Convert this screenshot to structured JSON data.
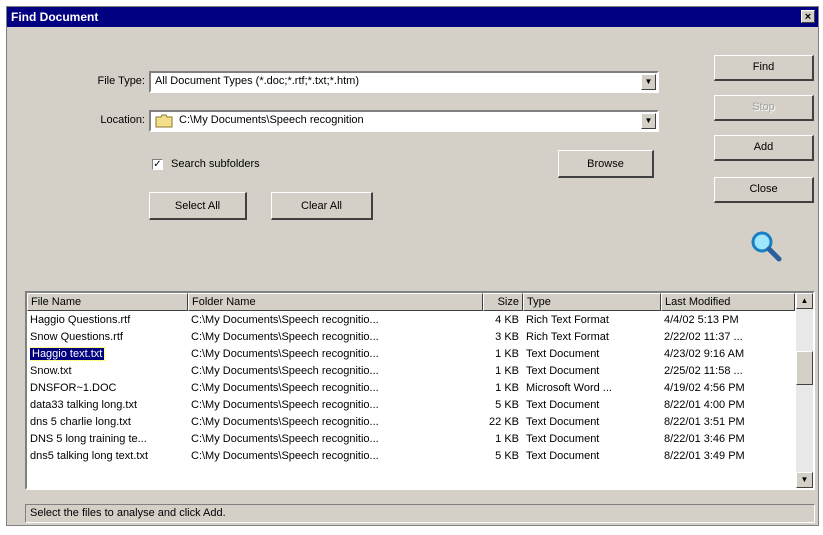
{
  "window": {
    "title": "Find Document",
    "close_glyph": "×"
  },
  "form": {
    "file_type_label": "File Type:",
    "file_type_value": "All Document Types (*.doc;*.rtf;*.txt;*.htm)",
    "location_label": "Location:",
    "location_value": "C:\\My Documents\\Speech recognition",
    "search_subfolders_label": "Search subfolders",
    "search_subfolders_checked": true,
    "browse_label": "Browse",
    "select_all_label": "Select All",
    "clear_all_label": "Clear All"
  },
  "buttons": {
    "find": "Find",
    "stop": "Stop",
    "add": "Add",
    "close": "Close"
  },
  "icons": {
    "search": "magnifier-icon",
    "folder": "folder-icon"
  },
  "table": {
    "columns": [
      "File Name",
      "Folder Name",
      "Size",
      "Type",
      "Last Modified"
    ],
    "rows": [
      [
        "Haggio Questions.rtf",
        "C:\\My Documents\\Speech recognitio...",
        "4 KB",
        "Rich Text Format",
        "4/4/02 5:13 PM"
      ],
      [
        "Snow Questions.rtf",
        "C:\\My Documents\\Speech recognitio...",
        "3 KB",
        "Rich Text Format",
        "2/22/02 11:37 ..."
      ],
      [
        "Haggio text.txt",
        "C:\\My Documents\\Speech recognitio...",
        "1 KB",
        "Text Document",
        "4/23/02 9:16 AM"
      ],
      [
        "Snow.txt",
        "C:\\My Documents\\Speech recognitio...",
        "1 KB",
        "Text Document",
        "2/25/02 11:58 ..."
      ],
      [
        "DNSFOR~1.DOC",
        "C:\\My Documents\\Speech recognitio...",
        "1 KB",
        "Microsoft Word ...",
        "4/19/02 4:56 PM"
      ],
      [
        "data33 talking long.txt",
        "C:\\My Documents\\Speech recognitio...",
        "5 KB",
        "Text Document",
        "8/22/01 4:00 PM"
      ],
      [
        "dns 5 charlie long.txt",
        "C:\\My Documents\\Speech recognitio...",
        "22 KB",
        "Text Document",
        "8/22/01 3:51 PM"
      ],
      [
        "DNS 5 long training te...",
        "C:\\My Documents\\Speech recognitio...",
        "1 KB",
        "Text Document",
        "8/22/01 3:46 PM"
      ],
      [
        "dns5 talking long text.txt",
        "C:\\My Documents\\Speech recognitio...",
        "5 KB",
        "Text Document",
        "8/22/01 3:49 PM"
      ]
    ],
    "selected_row": 2
  },
  "status_text": "Select the files to analyse and click Add.",
  "colors": {
    "titlebar": "#000080",
    "face": "#d4d0c8",
    "selection": "#000080"
  }
}
